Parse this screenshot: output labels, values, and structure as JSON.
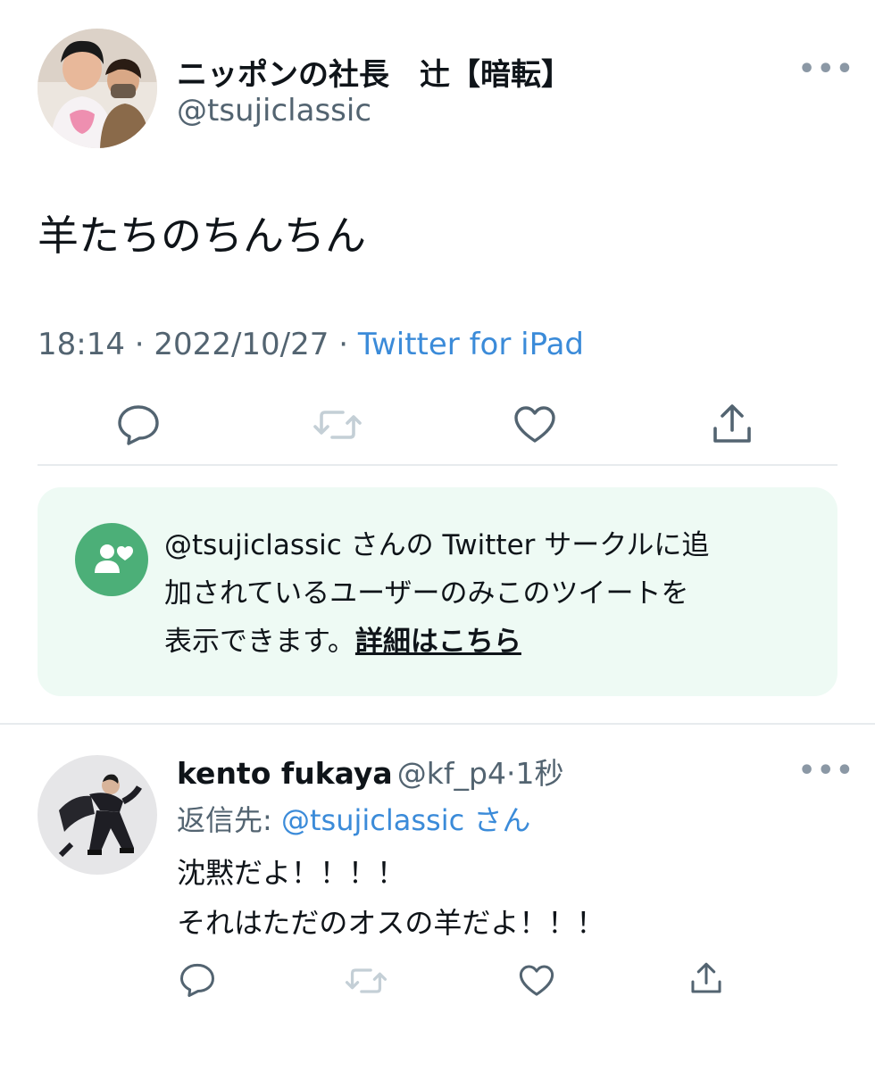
{
  "tweet": {
    "author_name": "ニッポンの社長　辻【暗転】",
    "author_handle": "@tsujiclassic",
    "more_label": "•••",
    "text": "羊たちのちんちん",
    "time": "18:14",
    "separator": " · ",
    "date": "2022/10/27",
    "source": "Twitter for iPad",
    "actions": [
      "reply-icon",
      "retweet-icon",
      "like-icon",
      "share-icon"
    ]
  },
  "circle_notice": {
    "icon": "circle-users-icon",
    "line1": "@tsujiclassic さんの Twitter サークルに追",
    "line2": "加されているユーザーのみこのツイートを",
    "line3": "表示できます。",
    "link_label": "詳細はこちら",
    "accent_color": "#4caf78",
    "background": "#eefaf4"
  },
  "reply": {
    "author_name": "kento fukaya",
    "author_handle": "@kf_p4",
    "separator": "·",
    "time": "1秒",
    "more_label": "•••",
    "reply_to_prefix": "返信先: ",
    "reply_to_mention": "@tsujiclassic",
    "reply_to_suffix": " さん",
    "text_line1": "沈黙だよ！！！！",
    "text_line2": "それはただのオスの羊だよ！！！",
    "actions": [
      "reply-icon",
      "retweet-icon",
      "like-icon",
      "share-icon"
    ]
  },
  "colors": {
    "link": "#3b8bd9",
    "secondary_text": "#536471",
    "disabled_icon": "#c4cfd6"
  }
}
